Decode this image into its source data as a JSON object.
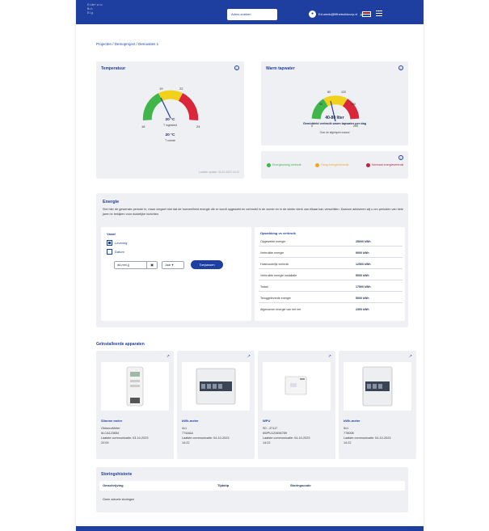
{
  "header": {
    "brand_lines": [
      "E Lite+ a l.o",
      "B.r.t.",
      "E.l.g"
    ],
    "search_label": "Adres zoeken",
    "user_email": "Ed.wenk@lifthebuildcorp.nl",
    "menu_icon": "hamburger-icon",
    "colors": {
      "primary": "#1e3fa0"
    }
  },
  "breadcrumb": {
    "items": [
      "Projecten",
      "Demoproject",
      "Demosites 1"
    ],
    "separator": "/"
  },
  "temperature": {
    "title": "Temperatuur",
    "gauge_value": 20,
    "gauge_min": 16,
    "gauge_max": 24,
    "ticks": [
      "16",
      "19",
      "22",
      "24"
    ],
    "setpoint_value": "20 °C",
    "setpoint_label": "T ingesteld",
    "room_value": "20 °C",
    "room_label": "T ruimte",
    "last_update": "Laatste update: 04-10-2023 14:22"
  },
  "hot_water": {
    "title": "Warm tapwater",
    "ticks": [
      "0",
      "40",
      "80",
      "120",
      "160",
      "200"
    ],
    "value_text": "40-80 liter",
    "caption": "Gemiddeld verbruik warm tapwater per dag",
    "subcaption": "Over de afgelopen maand"
  },
  "legend": {
    "items": [
      {
        "label": "Energiezuinig verbruik",
        "color": "#3fb54a"
      },
      {
        "label": "Hoog energieverbruik",
        "color": "#f5a623"
      },
      {
        "label": "Normaal energieverbruik",
        "color": "#c0233a"
      }
    ]
  },
  "energy": {
    "title": "Energie",
    "description": "Stel hier de gewenste periode in, maar vergeet niet dat de hoeveelheid energie die er wordt opgewekt en verbruikt in de zomer en in de winter sterk van elkaar kan verschillen. Daarom adviseren wij u om perioden van hele jaren te bekijken voor duidelijke inzichten.",
    "period_title": "Vanaf",
    "option_delivery": "Levering",
    "option_date": "Datum",
    "date_placeholder": "dd-mm-jj",
    "year_select": "Jaar",
    "apply_button": "Toepassen",
    "summary_title": "Opwekking vs verbruik",
    "rows": [
      {
        "label": "Opgewekte energie",
        "value": "25000 kWh"
      },
      {
        "label": "Verbruikte energie",
        "value": "9000 kWh"
      },
      {
        "label": "Huishoudelijk verbruik",
        "value": "12500 kWh"
      },
      {
        "label": "Verbruikte energie installatie",
        "value": "5000 kWh"
      },
      {
        "label": "Totaal",
        "value": "17500 kWh"
      },
      {
        "label": "Teruggeleverde energie",
        "value": "5000 kWh"
      },
      {
        "label": "Afgenomen energie van het net",
        "value": "2300 kWh"
      }
    ]
  },
  "devices": {
    "title": "Geïnstalleerde apparaten",
    "items": [
      {
        "name": "Slimme meter",
        "line1": "ObisecoMeter",
        "line2": "#LCA123654",
        "line3": "Laatste communicatie: 03-10-2023",
        "line4": "22:09"
      },
      {
        "name": "kWh-meter",
        "line1": "4v1",
        "line2": "774AAA",
        "line3": "Laatste communicatie: 04-10-2023",
        "line4": "14:22"
      },
      {
        "name": "WPU",
        "line1": "S0 - 47117",
        "line2": "#WPU123456789",
        "line3": "Laatste communicatie: 04-10-2023",
        "line4": "14:22"
      },
      {
        "name": "kWh-meter",
        "line1": "5v1",
        "line2": "778008",
        "line3": "Laatste communicatie: 04-10-2023",
        "line4": "14:22"
      }
    ]
  },
  "faults": {
    "title": "Storingshistorie",
    "columns": [
      "Omschrijving",
      "Tijdstip",
      "Storingscode"
    ],
    "empty": "Geen actuele storingen"
  }
}
